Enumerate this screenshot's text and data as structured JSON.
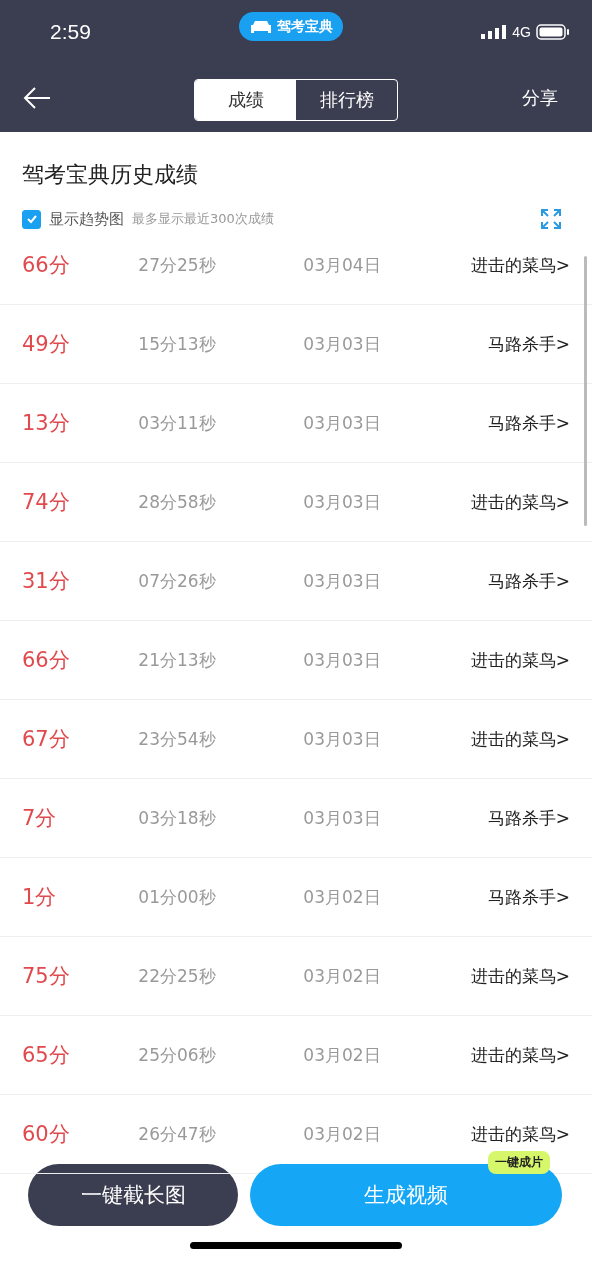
{
  "status_bar": {
    "time": "2:59",
    "app_badge": "驾考宝典",
    "network": "4G"
  },
  "nav": {
    "tabs": [
      {
        "label": "成绩",
        "selected": true
      },
      {
        "label": "排行榜",
        "selected": false
      }
    ],
    "share": "分享"
  },
  "title": "驾考宝典历史成绩",
  "trend": {
    "label": "显示趋势图",
    "checked": true,
    "note": "最多显示最近300次成绩"
  },
  "rows": [
    {
      "score": "66分",
      "duration": "27分25秒",
      "date": "03月04日",
      "rank": "进击的菜鸟>"
    },
    {
      "score": "49分",
      "duration": "15分13秒",
      "date": "03月03日",
      "rank": "马路杀手>"
    },
    {
      "score": "13分",
      "duration": "03分11秒",
      "date": "03月03日",
      "rank": "马路杀手>"
    },
    {
      "score": "74分",
      "duration": "28分58秒",
      "date": "03月03日",
      "rank": "进击的菜鸟>"
    },
    {
      "score": "31分",
      "duration": "07分26秒",
      "date": "03月03日",
      "rank": "马路杀手>"
    },
    {
      "score": "66分",
      "duration": "21分13秒",
      "date": "03月03日",
      "rank": "进击的菜鸟>"
    },
    {
      "score": "67分",
      "duration": "23分54秒",
      "date": "03月03日",
      "rank": "进击的菜鸟>"
    },
    {
      "score": "7分",
      "duration": "03分18秒",
      "date": "03月03日",
      "rank": "马路杀手>"
    },
    {
      "score": "1分",
      "duration": "01分00秒",
      "date": "03月02日",
      "rank": "马路杀手>"
    },
    {
      "score": "75分",
      "duration": "22分25秒",
      "date": "03月02日",
      "rank": "进击的菜鸟>"
    },
    {
      "score": "65分",
      "duration": "25分06秒",
      "date": "03月02日",
      "rank": "进击的菜鸟>"
    },
    {
      "score": "60分",
      "duration": "26分47秒",
      "date": "03月02日",
      "rank": "进击的菜鸟>"
    }
  ],
  "buttons": {
    "screenshot": "一键截长图",
    "video": "生成视频",
    "video_badge": "一键成片"
  }
}
